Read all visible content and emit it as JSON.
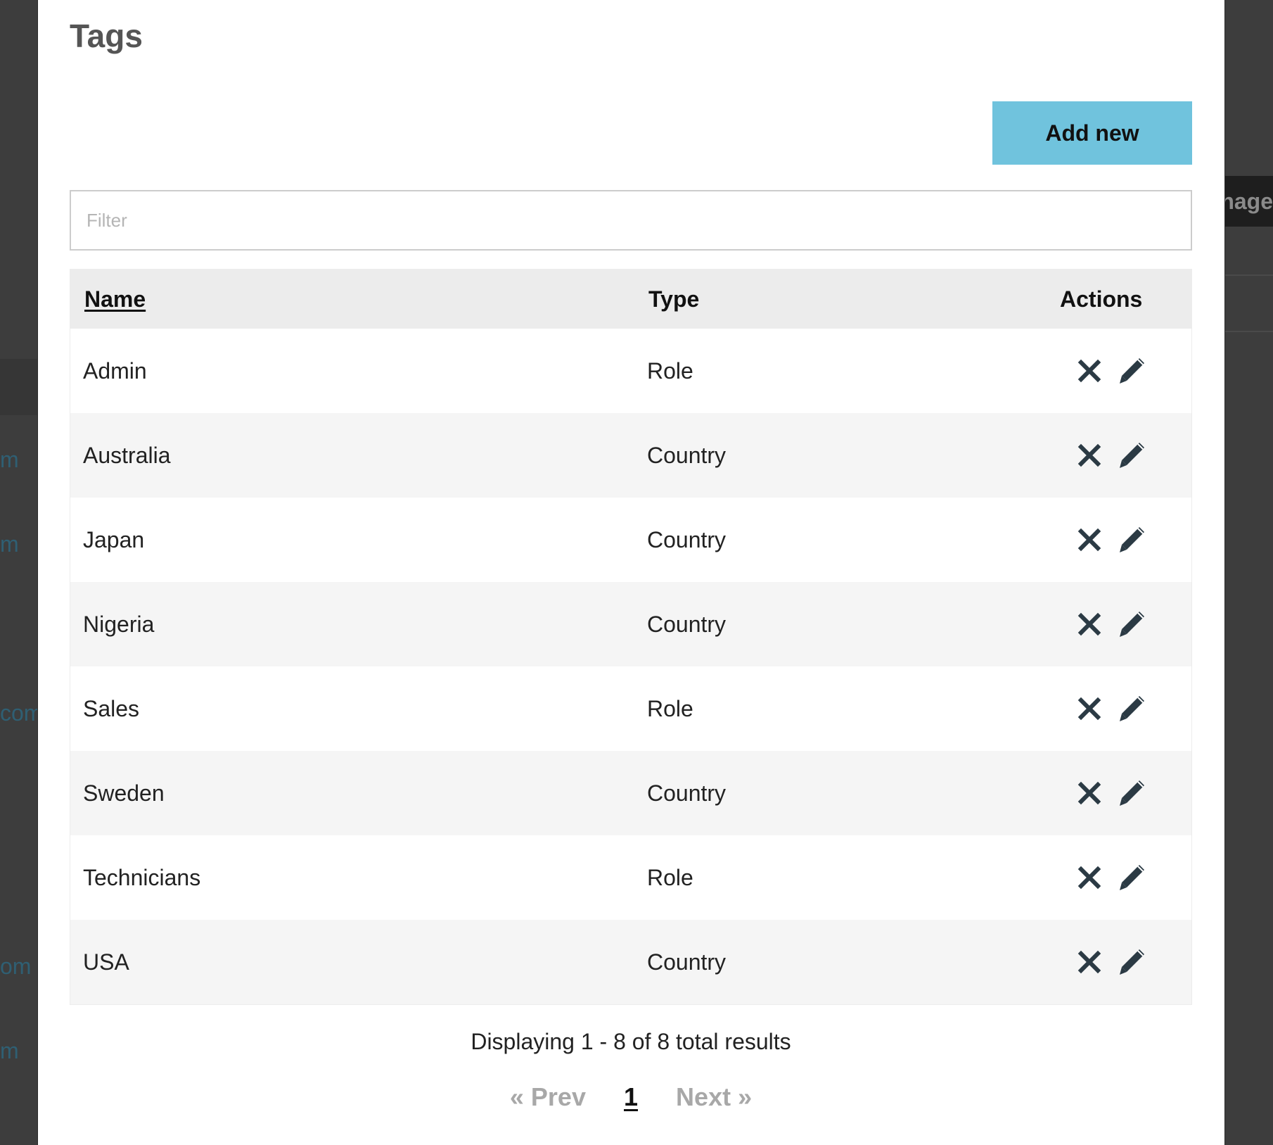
{
  "modal": {
    "title": "Tags",
    "add_button_label": "Add new",
    "filter_placeholder": "Filter"
  },
  "table": {
    "columns": [
      "Name",
      "Type",
      "Actions"
    ],
    "rows": [
      {
        "name": "Admin",
        "type": "Role"
      },
      {
        "name": "Australia",
        "type": "Country"
      },
      {
        "name": "Japan",
        "type": "Country"
      },
      {
        "name": "Nigeria",
        "type": "Country"
      },
      {
        "name": "Sales",
        "type": "Role"
      },
      {
        "name": "Sweden",
        "type": "Country"
      },
      {
        "name": "Technicians",
        "type": "Role"
      },
      {
        "name": "USA",
        "type": "Country"
      }
    ],
    "row_actions": [
      "close-icon",
      "pencil-icon"
    ]
  },
  "footer": {
    "results_text": "Displaying 1 - 8 of 8 total results",
    "prev_label": "« Prev",
    "current_page": "1",
    "next_label": "Next »"
  },
  "background": {
    "header_fragment": "anage",
    "link_fragments": [
      "m",
      "m",
      "com",
      "om",
      "m"
    ]
  },
  "colors": {
    "accent": "#70c3dd",
    "icon": "#2b3a44",
    "overlay": "#3d3d3d"
  }
}
